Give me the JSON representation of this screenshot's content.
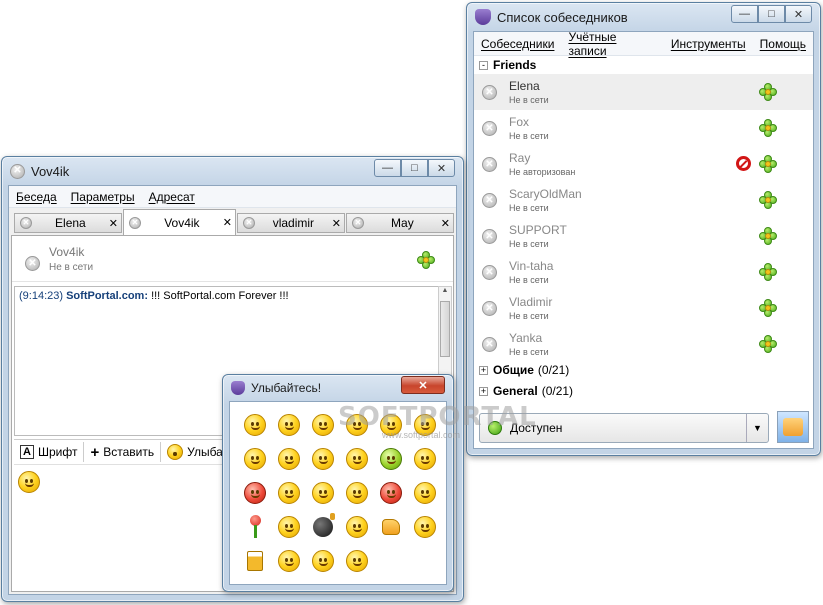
{
  "chat_window": {
    "title": "Vov4ik",
    "menu": [
      "Беседа",
      "Параметры",
      "Адресат"
    ],
    "tabs": [
      {
        "label": "Elena",
        "active": false
      },
      {
        "label": "Vov4ik",
        "active": true
      },
      {
        "label": "vladimir",
        "active": false
      },
      {
        "label": "May",
        "active": false
      }
    ],
    "contact": {
      "name": "Vov4ik",
      "status": "Не в сети"
    },
    "message": {
      "time": "(9:14:23)",
      "sender": "SoftPortal.com:",
      "text": "!!! SoftPortal.com Forever !!!"
    },
    "toolbar": {
      "font_label": "Шрифт",
      "insert_label": "Вставить",
      "smile_label": "Улыба"
    }
  },
  "contacts_window": {
    "title": "Список собеседников",
    "menu": [
      "Собеседники",
      "Учётные записи",
      "Инструменты",
      "Помощь"
    ],
    "group_friends": "Friends",
    "contacts": [
      {
        "name": "Elena",
        "status": "Не в сети",
        "blocked": false
      },
      {
        "name": "Fox",
        "status": "Не в сети",
        "blocked": false
      },
      {
        "name": "Ray",
        "status": "Не авторизован",
        "blocked": true
      },
      {
        "name": "ScaryOldMan",
        "status": "Не в сети",
        "blocked": false
      },
      {
        "name": "SUPPORT",
        "status": "Не в сети",
        "blocked": false
      },
      {
        "name": "Vin-taha",
        "status": "Не в сети",
        "blocked": false
      },
      {
        "name": "Vladimir",
        "status": "Не в сети",
        "blocked": false
      },
      {
        "name": "Yanka",
        "status": "Не в сети",
        "blocked": false
      }
    ],
    "group_general_ru": "Общие",
    "group_general_ru_count": "(0/21)",
    "group_general_en": "General",
    "group_general_en_count": "(0/21)",
    "presence": "Доступен"
  },
  "smiley_window": {
    "title": "Улыбайтесь!",
    "emoticons": [
      "smile",
      "neutral",
      "sad",
      "crying",
      "grin",
      "tongue",
      "headphones",
      "big-grin",
      "sleepy",
      "shocked",
      "sick",
      "wink",
      "angry",
      "kiss",
      "kiss-pair",
      "surprised",
      "devil",
      "angel",
      "rose",
      "confused",
      "bomb",
      "skeptical",
      "thumbs-up",
      "whistle",
      "beer",
      "laughing",
      "cool",
      "in-love"
    ]
  },
  "watermark": {
    "main": "SOFTPORTAL",
    "sub": "www.softportal.com"
  }
}
